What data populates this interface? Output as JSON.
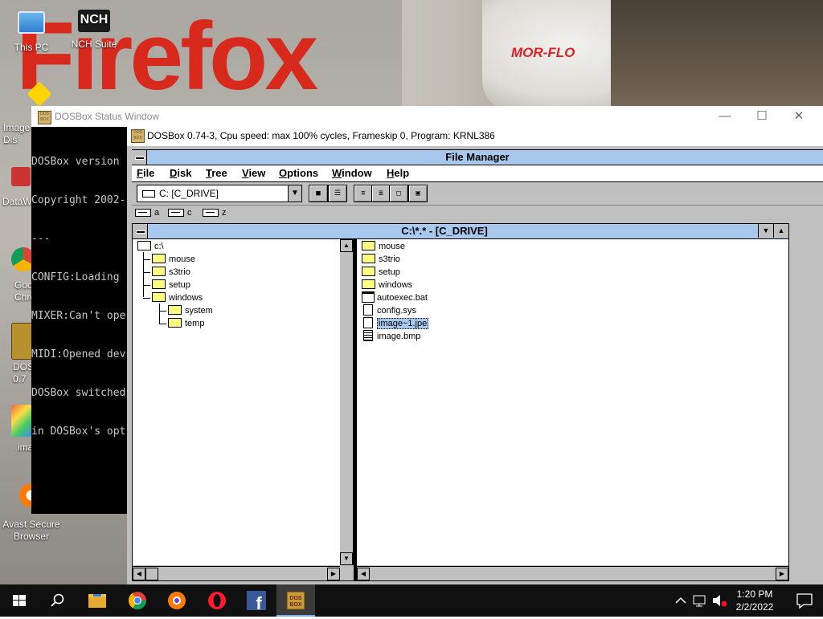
{
  "desktop": {
    "wallpaper_text": "Firefox",
    "heater_brand": "MOR-FLO",
    "icons": [
      {
        "label": "This PC"
      },
      {
        "label": "NCH Suite"
      },
      {
        "label": "Image\nDis"
      },
      {
        "label": "DataW"
      },
      {
        "label": "Goo\nChro"
      },
      {
        "label": "DOS\n0.7"
      },
      {
        "label": "ima"
      },
      {
        "label": "Avast Secure\nBrowser"
      }
    ]
  },
  "status_window": {
    "title": "DOSBox Status Window",
    "console_lines": [
      "DOSBox version",
      "Copyright 2002-",
      "---",
      "CONFIG:Loading",
      "MIXER:Can't ope",
      "MIDI:Opened dev",
      "DOSBox switched",
      "in DOSBox's opt"
    ]
  },
  "dosbox": {
    "title": "DOSBox 0.74-3, Cpu speed: max 100% cycles, Frameskip  0, Program:  KRNL386",
    "icon_text": "DOS BOX"
  },
  "file_manager": {
    "title": "File Manager",
    "menu": [
      "File",
      "Disk",
      "Tree",
      "View",
      "Options",
      "Window",
      "Help"
    ],
    "drive_select_value": "C: [C_DRIVE]",
    "drives": [
      "a",
      "c",
      "z"
    ],
    "directory_window_title": "C:\\*.* - [C_DRIVE]",
    "tree": {
      "root": "c:\\",
      "items": [
        "mouse",
        "s3trio",
        "setup",
        "windows",
        "system",
        "temp"
      ]
    },
    "files": [
      {
        "name": "mouse",
        "kind": "folder"
      },
      {
        "name": "s3trio",
        "kind": "folder"
      },
      {
        "name": "setup",
        "kind": "folder"
      },
      {
        "name": "windows",
        "kind": "folder"
      },
      {
        "name": "autoexec.bat",
        "kind": "batch"
      },
      {
        "name": "config.sys",
        "kind": "document"
      },
      {
        "name": "image~1.jpe",
        "kind": "document",
        "selected": true
      },
      {
        "name": "image.bmp",
        "kind": "text"
      }
    ]
  },
  "taskbar": {
    "time": "1:20 PM",
    "date": "2/2/2022"
  },
  "colors": {
    "win31_title": "#a8c8ee",
    "win31_face": "#c0c0c0",
    "taskbar": "#101010"
  }
}
